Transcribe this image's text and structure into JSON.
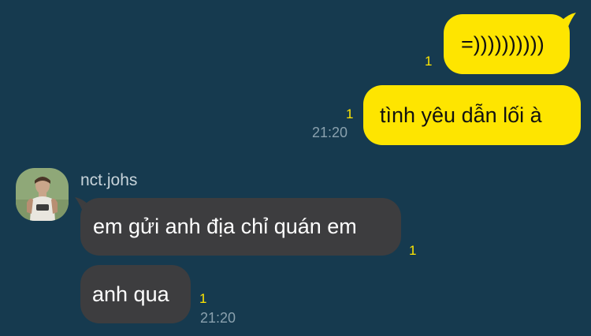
{
  "conversation": {
    "outgoing": [
      {
        "text": "=))))))))))",
        "unread": "1"
      },
      {
        "text": "tình yêu dẫn lối à",
        "unread": "1",
        "time": "21:20"
      }
    ],
    "contact": {
      "name": "nct.johs",
      "avatar_icon": "profile-photo"
    },
    "incoming": [
      {
        "text": "em gửi anh địa chỉ quán em",
        "unread": "1"
      },
      {
        "text": "anh qua",
        "unread": "1",
        "time": "21:20"
      }
    ]
  },
  "colors": {
    "background": "#163a4f",
    "outgoing_bubble": "#fee500",
    "incoming_bubble": "#3d3d3f",
    "unread_count": "#fee500",
    "timestamp": "#8aa1ae"
  }
}
